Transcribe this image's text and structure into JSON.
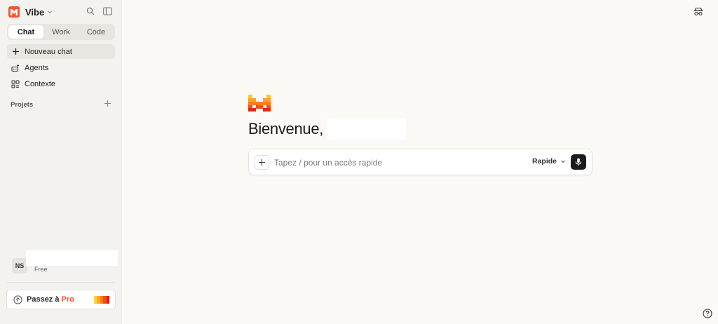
{
  "brand": {
    "name": "Vibe",
    "logo_letter": "M",
    "accent": "#f2552c"
  },
  "sidebar": {
    "tabs": [
      {
        "label": "Chat",
        "active": true
      },
      {
        "label": "Work",
        "active": false
      },
      {
        "label": "Code",
        "active": false
      }
    ],
    "items": [
      {
        "label": "Nouveau chat",
        "icon": "plus-icon",
        "active": true
      },
      {
        "label": "Agents",
        "icon": "agents-icon",
        "active": false
      },
      {
        "label": "Contexte",
        "icon": "context-icon",
        "active": false
      }
    ],
    "projects_label": "Projets",
    "user": {
      "initials": "NS",
      "plan": "Free"
    },
    "upgrade": {
      "label": "Passez à",
      "highlight": "Pro"
    }
  },
  "main": {
    "welcome": "Bienvenue,",
    "composer": {
      "placeholder": "Tapez / pour un accès rapide",
      "mode": "Rapide"
    }
  }
}
